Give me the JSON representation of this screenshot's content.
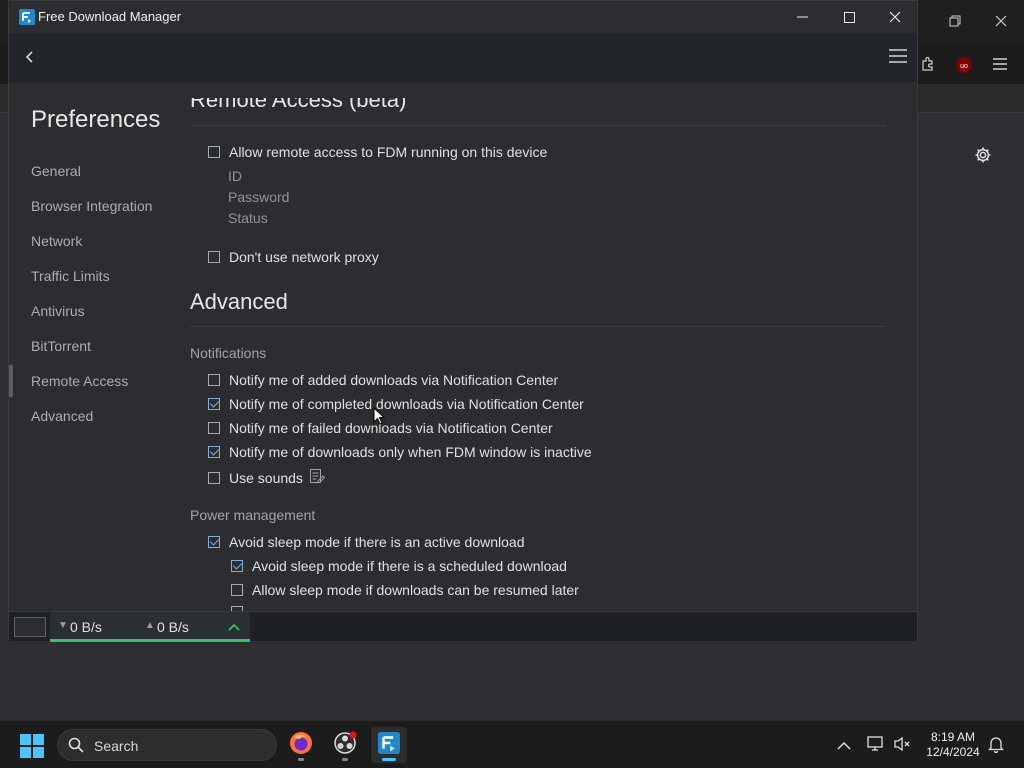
{
  "window": {
    "title": "Free Download Manager"
  },
  "sidebar": {
    "title": "Preferences",
    "items": [
      {
        "label": "General"
      },
      {
        "label": "Browser Integration"
      },
      {
        "label": "Network"
      },
      {
        "label": "Traffic Limits"
      },
      {
        "label": "Antivirus"
      },
      {
        "label": "BitTorrent"
      },
      {
        "label": "Remote Access"
      },
      {
        "label": "Advanced"
      }
    ],
    "active": "Remote Access"
  },
  "remote_access": {
    "title": "Remote Access (beta)",
    "allow_label": "Allow remote access to FDM running on this device",
    "allow_checked": false,
    "id_label": "ID",
    "password_label": "Password",
    "status_label": "Status",
    "proxy_label": "Don't use network proxy",
    "proxy_checked": false
  },
  "advanced": {
    "title": "Advanced",
    "notifications": {
      "title": "Notifications",
      "items": [
        {
          "label": "Notify me of added downloads via Notification Center",
          "checked": false
        },
        {
          "label": "Notify me of completed downloads via Notification Center",
          "checked": true
        },
        {
          "label": "Notify me of failed downloads via Notification Center",
          "checked": false
        },
        {
          "label": "Notify me of downloads only when FDM window is inactive",
          "checked": true
        },
        {
          "label": "Use sounds",
          "checked": false
        }
      ]
    },
    "power": {
      "title": "Power management",
      "items": [
        {
          "label": "Avoid sleep mode if there is an active download",
          "checked": true
        },
        {
          "label": "Avoid sleep mode if there is a scheduled download",
          "checked": true
        },
        {
          "label": "Allow sleep mode if downloads can be resumed later",
          "checked": false
        }
      ]
    }
  },
  "statusbar": {
    "download_speed": "0 B/s",
    "upload_speed": "0 B/s"
  },
  "taskbar": {
    "search_label": "Search",
    "time": "8:19 AM",
    "date": "12/4/2024"
  },
  "colors": {
    "accent_green": "#35c36a",
    "checkbox_checked": "#7fb0d6"
  }
}
